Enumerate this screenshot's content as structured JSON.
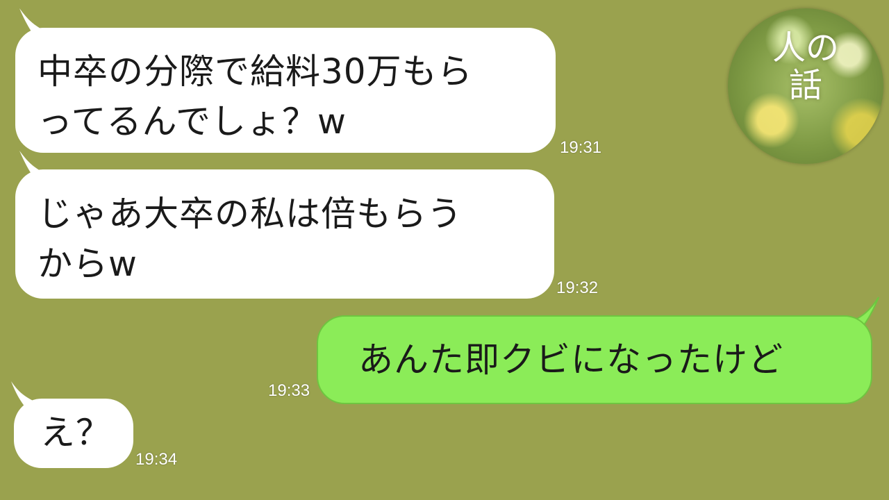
{
  "channel_logo": {
    "text": "人の\n話"
  },
  "messages": [
    {
      "side": "incoming",
      "text": "中卒の分際で給料30万もら\nってるんでしょ？w",
      "time": "19:31"
    },
    {
      "side": "incoming",
      "text": "じゃあ大卒の私は倍もらう\nからw",
      "time": "19:32"
    },
    {
      "side": "outgoing",
      "text": "あんた即クビになったけど",
      "time": "19:33"
    },
    {
      "side": "incoming",
      "text": "え？",
      "time": "19:34"
    }
  ],
  "colors": {
    "background": "#9aa24e",
    "incoming_bubble": "#ffffff",
    "outgoing_bubble": "#8bec58",
    "timestamp": "#ffffff"
  }
}
